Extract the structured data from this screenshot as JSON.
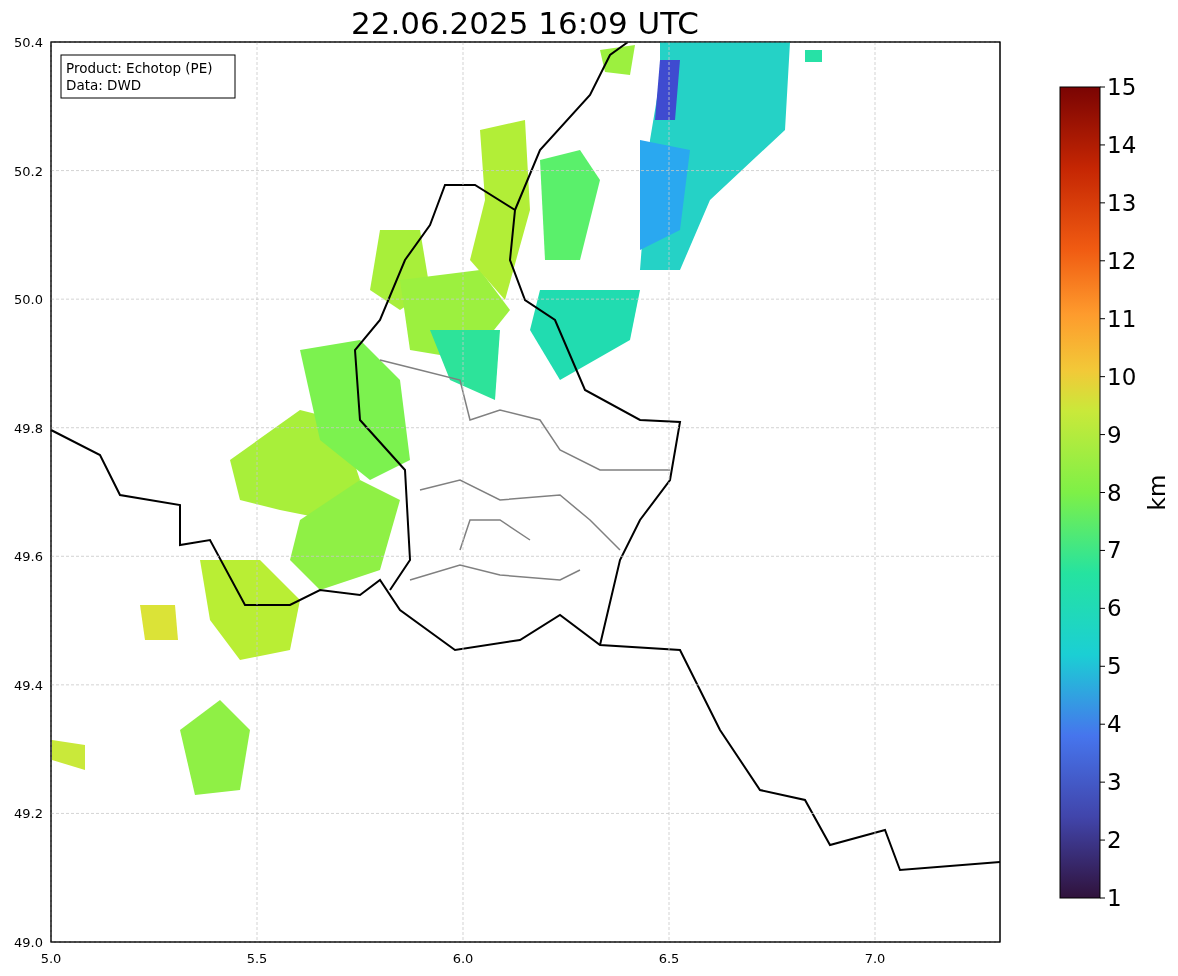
{
  "title": "22.06.2025 16:09 UTC",
  "legend": [
    "Product: Echotop (PE)",
    "Data: DWD"
  ],
  "y_ticks": [
    "50.4",
    "50.2",
    "50.0",
    "49.8",
    "49.6",
    "49.4",
    "49.2",
    "49.0"
  ],
  "x_ticks": [
    "5.0",
    "5.5",
    "6.0",
    "6.5",
    "7.0"
  ],
  "colorbar": {
    "label": "km",
    "ticks": [
      "15",
      "14",
      "13",
      "12",
      "11",
      "10",
      "9",
      "8",
      "7",
      "6",
      "5",
      "4",
      "3",
      "2",
      "1"
    ]
  }
}
